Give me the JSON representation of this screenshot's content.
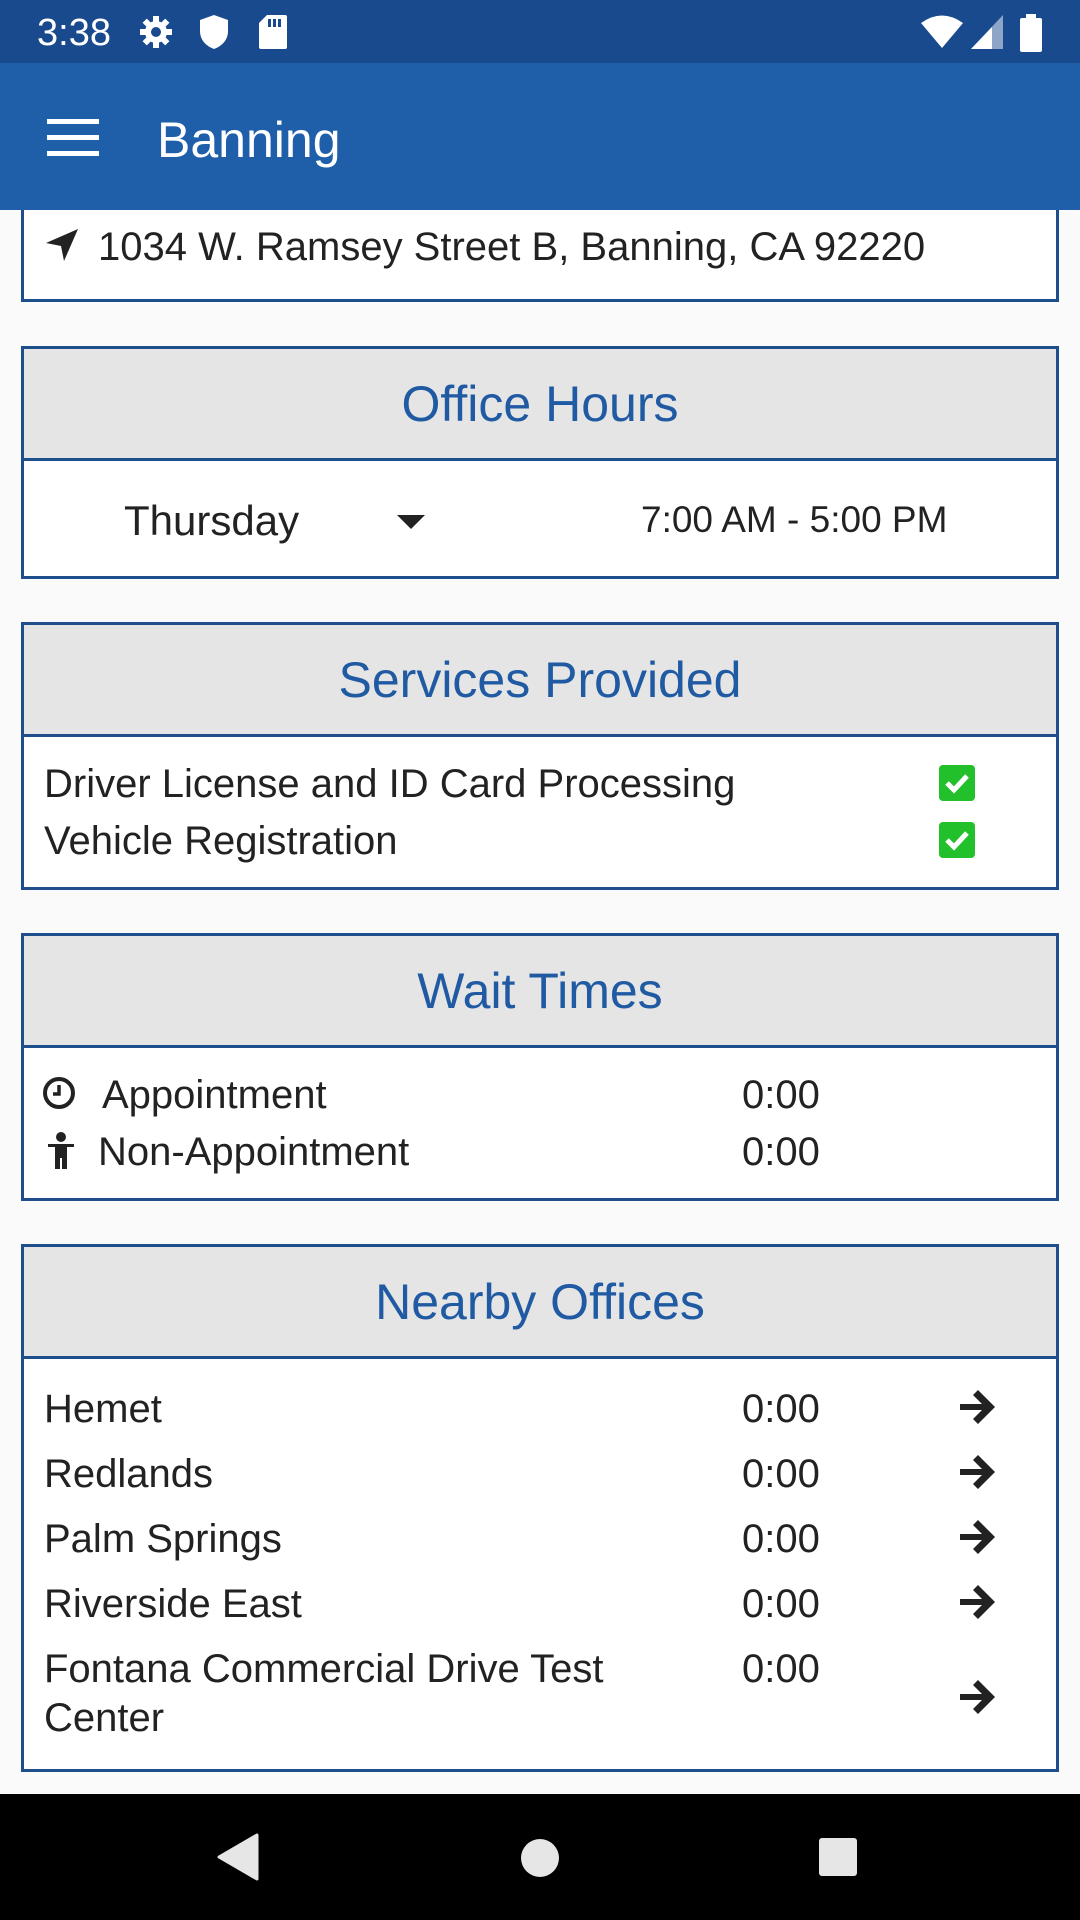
{
  "status_bar": {
    "time": "3:38"
  },
  "app_bar": {
    "title": "Banning",
    "menu_icon": "hamburger-menu-icon"
  },
  "address": {
    "text": "1034 W. Ramsey Street B, Banning, CA 92220",
    "icon": "location-arrow-icon"
  },
  "office_hours": {
    "heading": "Office Hours",
    "day": "Thursday",
    "hours": "7:00 AM - 5:00 PM"
  },
  "services": {
    "heading": "Services Provided",
    "items": [
      {
        "label": "Driver License and ID Card Processing",
        "checked": true
      },
      {
        "label": "Vehicle Registration",
        "checked": true
      }
    ]
  },
  "wait_times": {
    "heading": "Wait Times",
    "rows": [
      {
        "label": "Appointment",
        "value": "0:00",
        "icon": "clock-icon"
      },
      {
        "label": "Non-Appointment",
        "value": "0:00",
        "icon": "person-icon"
      }
    ]
  },
  "nearby": {
    "heading": "Nearby Offices",
    "offices": [
      {
        "name": "Hemet",
        "wait": "0:00"
      },
      {
        "name": "Redlands",
        "wait": "0:00"
      },
      {
        "name": "Palm Springs",
        "wait": "0:00"
      },
      {
        "name": "Riverside East",
        "wait": "0:00"
      },
      {
        "name_line1": "Fontana Commercial Drive Test",
        "name_line2": "Center",
        "wait": "0:00"
      }
    ]
  },
  "colors": {
    "status_bar": "#1a4a8e",
    "app_bar": "#1f5ea8",
    "heading_text": "#1f5aa3",
    "border": "#1f4e8d",
    "check": "#22c02a"
  }
}
